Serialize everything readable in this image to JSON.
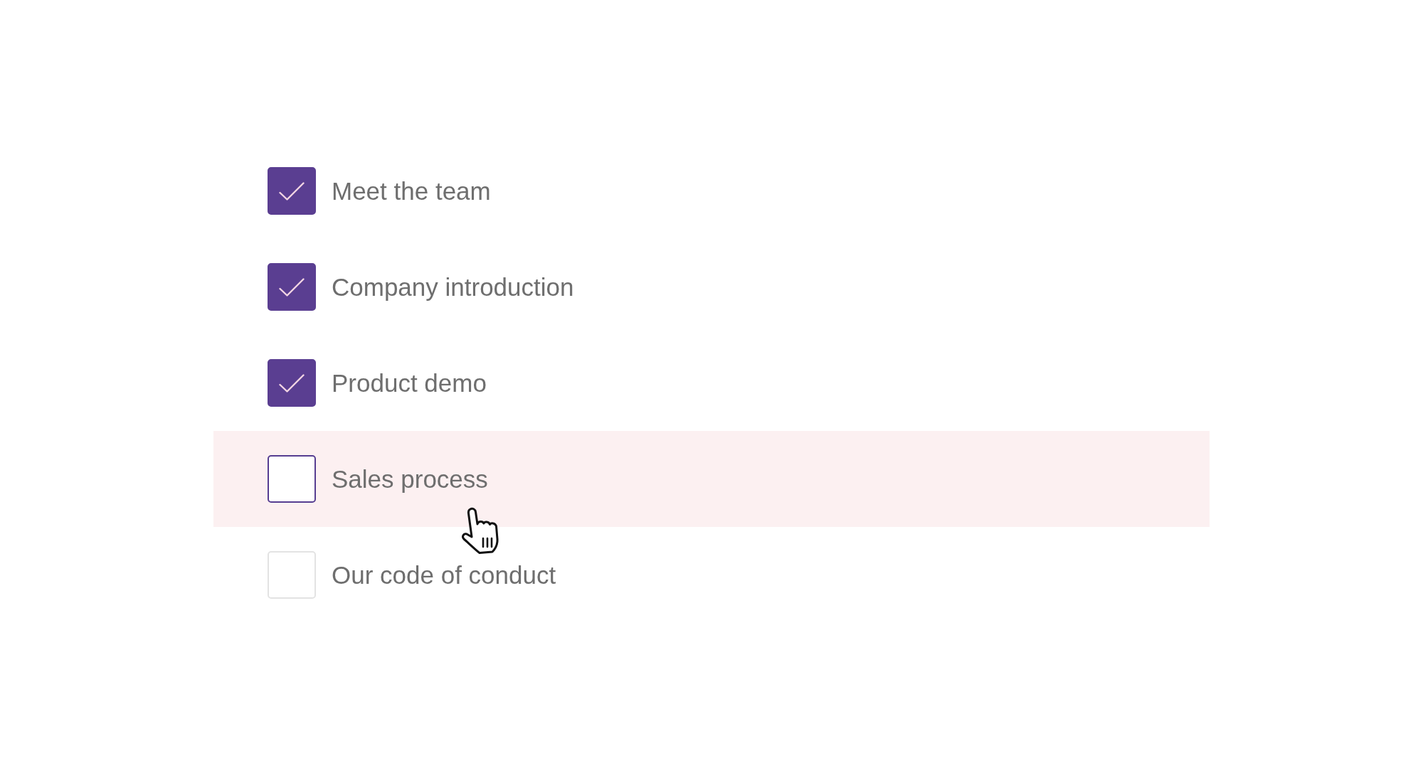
{
  "checklist": {
    "items": [
      {
        "label": "Meet the team",
        "checked": true,
        "highlighted": false
      },
      {
        "label": "Company introduction",
        "checked": true,
        "highlighted": false
      },
      {
        "label": "Product demo",
        "checked": true,
        "highlighted": false
      },
      {
        "label": "Sales process",
        "checked": false,
        "highlighted": true
      },
      {
        "label": "Our code of conduct",
        "checked": false,
        "highlighted": false
      }
    ]
  }
}
